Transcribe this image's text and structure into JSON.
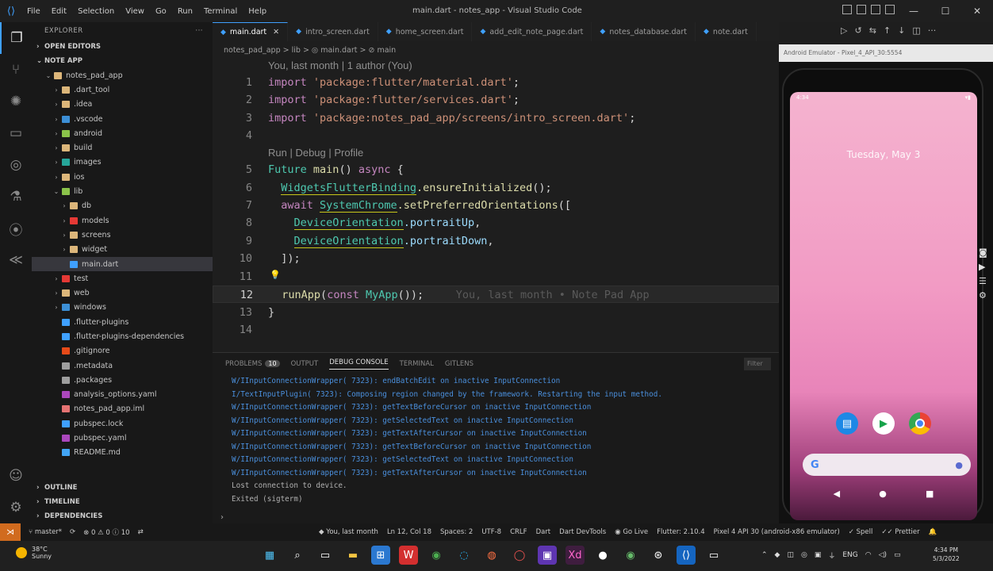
{
  "window": {
    "title": "main.dart - notes_app - Visual Studio Code",
    "menu": [
      "File",
      "Edit",
      "Selection",
      "View",
      "Go",
      "Run",
      "Terminal",
      "Help"
    ]
  },
  "explorer": {
    "header": "EXPLORER",
    "open_editors": "OPEN EDITORS",
    "root": "NOTE APP",
    "items": [
      {
        "label": "notes_pad_app",
        "depth": 1,
        "chev": "⌄",
        "color": "#dcb67a"
      },
      {
        "label": ".dart_tool",
        "depth": 2,
        "chev": "›",
        "color": "#dcb67a"
      },
      {
        "label": ".idea",
        "depth": 2,
        "chev": "›",
        "color": "#dcb67a"
      },
      {
        "label": ".vscode",
        "depth": 2,
        "chev": "›",
        "color": "#3c8fd6"
      },
      {
        "label": "android",
        "depth": 2,
        "chev": "›",
        "color": "#8bc34a"
      },
      {
        "label": "build",
        "depth": 2,
        "chev": "›",
        "color": "#dcb67a"
      },
      {
        "label": "images",
        "depth": 2,
        "chev": "›",
        "color": "#26a69a"
      },
      {
        "label": "ios",
        "depth": 2,
        "chev": "›",
        "color": "#dcb67a"
      },
      {
        "label": "lib",
        "depth": 2,
        "chev": "⌄",
        "color": "#8bc34a"
      },
      {
        "label": "db",
        "depth": 3,
        "chev": "›",
        "color": "#dcb67a"
      },
      {
        "label": "models",
        "depth": 3,
        "chev": "›",
        "color": "#e53935"
      },
      {
        "label": "screens",
        "depth": 3,
        "chev": "›",
        "color": "#dcb67a"
      },
      {
        "label": "widget",
        "depth": 3,
        "chev": "›",
        "color": "#dcb67a"
      },
      {
        "label": "main.dart",
        "depth": 3,
        "chev": "",
        "color": "#3fa0ff"
      },
      {
        "label": "test",
        "depth": 2,
        "chev": "›",
        "color": "#e53935"
      },
      {
        "label": "web",
        "depth": 2,
        "chev": "›",
        "color": "#dcb67a"
      },
      {
        "label": "windows",
        "depth": 2,
        "chev": "›",
        "color": "#3c8fd6"
      },
      {
        "label": ".flutter-plugins",
        "depth": 2,
        "chev": "",
        "color": "#3fa0ff"
      },
      {
        "label": ".flutter-plugins-dependencies",
        "depth": 2,
        "chev": "",
        "color": "#3fa0ff"
      },
      {
        "label": ".gitignore",
        "depth": 2,
        "chev": "",
        "color": "#e64a19"
      },
      {
        "label": ".metadata",
        "depth": 2,
        "chev": "",
        "color": "#9e9e9e"
      },
      {
        "label": ".packages",
        "depth": 2,
        "chev": "",
        "color": "#9e9e9e"
      },
      {
        "label": "analysis_options.yaml",
        "depth": 2,
        "chev": "",
        "color": "#ab47bc"
      },
      {
        "label": "notes_pad_app.iml",
        "depth": 2,
        "chev": "",
        "color": "#e57373"
      },
      {
        "label": "pubspec.lock",
        "depth": 2,
        "chev": "",
        "color": "#3fa0ff"
      },
      {
        "label": "pubspec.yaml",
        "depth": 2,
        "chev": "",
        "color": "#ab47bc"
      },
      {
        "label": "README.md",
        "depth": 2,
        "chev": "",
        "color": "#42a5f5"
      }
    ],
    "outline": "OUTLINE",
    "timeline": "TIMELINE",
    "dependencies": "DEPENDENCIES"
  },
  "tabs": [
    {
      "label": "main.dart",
      "active": true,
      "close": "✕"
    },
    {
      "label": "intro_screen.dart",
      "active": false
    },
    {
      "label": "home_screen.dart",
      "active": false
    },
    {
      "label": "add_edit_note_page.dart",
      "active": false
    },
    {
      "label": "notes_database.dart",
      "active": false
    },
    {
      "label": "note.dart",
      "active": false
    }
  ],
  "breadcrumb": "notes_pad_app > lib > ◎ main.dart > ⊘ main",
  "codelens_blame": "You, last month | 1 author (You)",
  "codelens_run": "Run | Debug | Profile",
  "line_numbers": [
    "1",
    "2",
    "3",
    "4",
    "5",
    "6",
    "7",
    "8",
    "9",
    "10",
    "11",
    "12",
    "13",
    "14"
  ],
  "code": {
    "l1_kw": "import",
    "l1_str": "'package:flutter/material.dart'",
    "l1_end": ";",
    "l2_kw": "import",
    "l2_str": "'package:flutter/services.dart'",
    "l2_end": ";",
    "l3_kw": "import",
    "l3_str": "'package:notes_pad_app/screens/intro_screen.dart'",
    "l3_end": ";",
    "l5_ty": "Future",
    "l5_fn": "main",
    "l5_p": "()",
    "l5_kw": "async",
    "l5_b": "{",
    "l6_ty": "WidgetsFlutterBinding",
    "l6_fn": ".ensureInitialized",
    "l6_p": "();",
    "l7_kw": "await",
    "l7_ty": "SystemChrome",
    "l7_fn": ".setPreferredOrientations",
    "l7_p": "([",
    "l8_ty": "DeviceOrientation",
    "l8_vr": ".portraitUp",
    "l8_p": ",",
    "l9_ty": "DeviceOrientation",
    "l9_vr": ".portraitDown",
    "l9_p": ",",
    "l10_p": "]);",
    "l12_fn": "runApp",
    "l12_p1": "(",
    "l12_kw": "const",
    "l12_ty": "MyApp",
    "l12_p2": "());",
    "l12_ghost": "You, last month • Note Pad App",
    "l13_p": "}"
  },
  "panel": {
    "tabs": [
      "PROBLEMS",
      "OUTPUT",
      "DEBUG CONSOLE",
      "TERMINAL",
      "GITLENS"
    ],
    "problems_count": "10",
    "filter": "Filter",
    "log": [
      "W/IInputConnectionWrapper( 7323): endBatchEdit on inactive InputConnection",
      "I/TextInputPlugin( 7323): Composing region changed by the framework. Restarting the input method.",
      "W/IInputConnectionWrapper( 7323): getTextBeforeCursor on inactive InputConnection",
      "W/IInputConnectionWrapper( 7323): getSelectedText on inactive InputConnection",
      "W/IInputConnectionWrapper( 7323): getTextAfterCursor on inactive InputConnection",
      "W/IInputConnectionWrapper( 7323): getTextBeforeCursor on inactive InputConnection",
      "W/IInputConnectionWrapper( 7323): getSelectedText on inactive InputConnection",
      "W/IInputConnectionWrapper( 7323): getTextAfterCursor on inactive InputConnection",
      "Lost connection to device.",
      "Exited (sigterm)"
    ],
    "prompt": "›"
  },
  "emulator": {
    "title": "Android Emulator - Pixel_4_API_30:5554",
    "status_time": "4:34",
    "date": "Tuesday, May 3",
    "search_g": "G"
  },
  "statusbar": {
    "branch": "master*",
    "problems": "⊗ 0 ⚠ 0 ⓘ 10",
    "blame": "You, last month",
    "position": "Ln 12, Col 18",
    "spaces": "Spaces: 2",
    "encoding": "UTF-8",
    "eol": "CRLF",
    "language": "Dart",
    "devtools": "Dart DevTools",
    "golive": "Go Live",
    "flutter": "Flutter: 2.10.4",
    "device": "Pixel 4 API 30 (android-x86 emulator)",
    "spell": "Spell",
    "prettier": "Prettier"
  },
  "taskbar": {
    "temp": "38°C",
    "weather": "Sunny",
    "lang": "ENG",
    "time": "4:34 PM",
    "date": "5/3/2022"
  }
}
